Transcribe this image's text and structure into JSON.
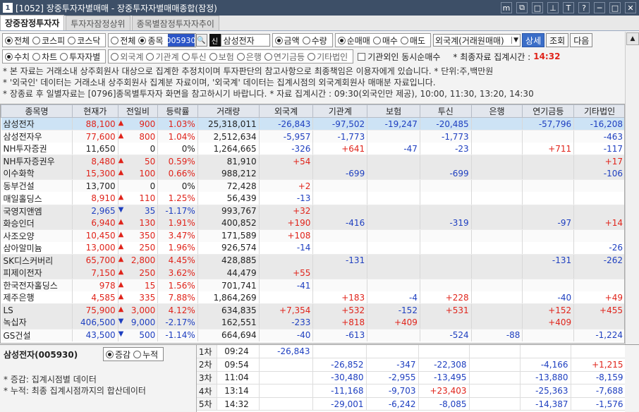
{
  "title": {
    "num": "1",
    "text": "[1052] 장중투자자별매매 - 장중투자자별매매종합(잠정)"
  },
  "titlebar_icons": [
    "m",
    "⧉",
    "□",
    "⊥",
    "T",
    "?",
    "─",
    "□",
    "✕"
  ],
  "tabs": [
    "장중잠정투자자",
    "투자자잠정상위",
    "종목별잠정투자자추이"
  ],
  "toolbar": {
    "market": [
      "전체",
      "코스피",
      "코스닥"
    ],
    "scope": [
      "전체",
      "종목"
    ],
    "code": "005930",
    "search_icon": "🔍",
    "shin": "신",
    "stock_name": "삼성전자",
    "unit": [
      "금액",
      "수량"
    ],
    "trade": [
      "순매매",
      "매수",
      "매도"
    ],
    "investor_select": "외국계(거래원매매)",
    "detail": "상세",
    "query": "조회",
    "next": "다음"
  },
  "toolbar2": {
    "view": [
      "수치",
      "차트",
      "투자자별"
    ],
    "inv": [
      "외국계",
      "기관계",
      "투신",
      "보험",
      "은행",
      "연기금등",
      "기타법인"
    ],
    "check_label": "기관외인 동시순매수",
    "time_label": "* 최종자료 집계시간 :",
    "time_value": "14:32"
  },
  "info": [
    "* 본 자료는 거래소내 상주회원사 대상으로 집계한 추정치이며 투자판단의 참고사항으로 최종책임은 이용자에게 있습니다.     * 단위:주,백만원",
    "* '외국인' 데이터는 거래소내 상주회원사 집계분 자료이며, '외국계' 데이터는 집계시점의 외국계회원사 매매분 자료입니다.",
    "* 장종료 후 일별자료는 [0796]종목별투자자 화면을 참고하시기 바랍니다.  * 자료 집계시간 : 09:30(외국인만 제공), 10:00, 11:30, 13:20, 14:30"
  ],
  "columns": [
    "종목명",
    "현재가",
    "전일비",
    "등락률",
    "거래량",
    "외국계",
    "기관계",
    "보험",
    "투신",
    "은행",
    "연기금등",
    "기타법인"
  ],
  "rows": [
    [
      "삼성전자",
      "88,100",
      "up",
      "900",
      "1.03%",
      "25,318,011",
      "-26,843",
      "-97,502",
      "-19,247",
      "-20,485",
      "",
      "-57,796",
      "-16,208"
    ],
    [
      "삼성전자우",
      "77,600",
      "up",
      "800",
      "1.04%",
      "2,512,634",
      "-5,957",
      "-1,773",
      "",
      "-1,773",
      "",
      "",
      "-463"
    ],
    [
      "NH투자증권",
      "11,650",
      "",
      "0",
      "0%",
      "1,264,665",
      "-326",
      "+641",
      "-47",
      "-23",
      "",
      "+711",
      "-117"
    ],
    [
      "NH투자증권우",
      "8,480",
      "up",
      "50",
      "0.59%",
      "81,910",
      "+54",
      "",
      "",
      "",
      "",
      "",
      "+17"
    ],
    [
      "이수화학",
      "15,300",
      "up",
      "100",
      "0.66%",
      "988,212",
      "",
      "-699",
      "",
      "-699",
      "",
      "",
      "-106"
    ],
    [
      "동부건설",
      "13,700",
      "",
      "0",
      "0%",
      "72,428",
      "+2",
      "",
      "",
      "",
      "",
      "",
      ""
    ],
    [
      "매일홀딩스",
      "8,910",
      "up",
      "110",
      "1.25%",
      "56,439",
      "-13",
      "",
      "",
      "",
      "",
      "",
      ""
    ],
    [
      "국영지앤엠",
      "2,965",
      "dn",
      "35",
      "-1.17%",
      "993,767",
      "+32",
      "",
      "",
      "",
      "",
      "",
      ""
    ],
    [
      "화승인더",
      "6,940",
      "up",
      "130",
      "1.91%",
      "400,852",
      "+190",
      "-416",
      "",
      "-319",
      "",
      "-97",
      "+14"
    ],
    [
      "사조오양",
      "10,450",
      "up",
      "350",
      "3.47%",
      "171,589",
      "+108",
      "",
      "",
      "",
      "",
      "",
      ""
    ],
    [
      "삼아알미늄",
      "13,000",
      "up",
      "250",
      "1.96%",
      "926,574",
      "-14",
      "",
      "",
      "",
      "",
      "",
      "-26"
    ],
    [
      "SK디스커버리",
      "65,700",
      "up",
      "2,800",
      "4.45%",
      "428,885",
      "",
      "-131",
      "",
      "",
      "",
      "-131",
      "-262"
    ],
    [
      "피제이전자",
      "7,150",
      "up",
      "250",
      "3.62%",
      "44,479",
      "+55",
      "",
      "",
      "",
      "",
      "",
      ""
    ],
    [
      "한국전자홀딩스",
      "978",
      "up",
      "15",
      "1.56%",
      "701,741",
      "-41",
      "",
      "",
      "",
      "",
      "",
      ""
    ],
    [
      "제주은행",
      "4,585",
      "up",
      "335",
      "7.88%",
      "1,864,269",
      "",
      "+183",
      "-4",
      "+228",
      "",
      "-40",
      "+49"
    ],
    [
      "LS",
      "75,900",
      "up",
      "3,000",
      "4.12%",
      "634,835",
      "+7,354",
      "+532",
      "-152",
      "+531",
      "",
      "+152",
      "+455"
    ],
    [
      "녹십자",
      "406,500",
      "dn",
      "9,000",
      "-2.17%",
      "162,551",
      "-233",
      "+818",
      "+409",
      "",
      "",
      "+409",
      ""
    ],
    [
      "GS건설",
      "43,500",
      "dn",
      "500",
      "-1.14%",
      "664,694",
      "-40",
      "-613",
      "",
      "-524",
      "-88",
      "",
      "-1,224"
    ]
  ],
  "bottom": {
    "title": "삼성전자(005930)",
    "rads": [
      "증감",
      "누적"
    ],
    "notes": [
      "* 증감: 집계시점별 데이터",
      "* 누적: 최종 집계시점까지의 합산데이터"
    ],
    "rows": [
      [
        "1차",
        "09:24",
        "-26,843",
        "",
        "",
        "",
        "",
        "",
        ""
      ],
      [
        "2차",
        "09:54",
        "",
        "-26,852",
        "-347",
        "-22,308",
        "",
        "-4,166",
        "+1,215"
      ],
      [
        "3차",
        "11:04",
        "",
        "-30,480",
        "-2,955",
        "-13,495",
        "",
        "-13,880",
        "-8,159"
      ],
      [
        "4차",
        "13:14",
        "",
        "-11,168",
        "-9,703",
        "+23,403",
        "",
        "-25,363",
        "-7,688"
      ],
      [
        "5차",
        "14:32",
        "",
        "-29,001",
        "-6,242",
        "-8,085",
        "",
        "-14,387",
        "-1,576"
      ]
    ]
  }
}
